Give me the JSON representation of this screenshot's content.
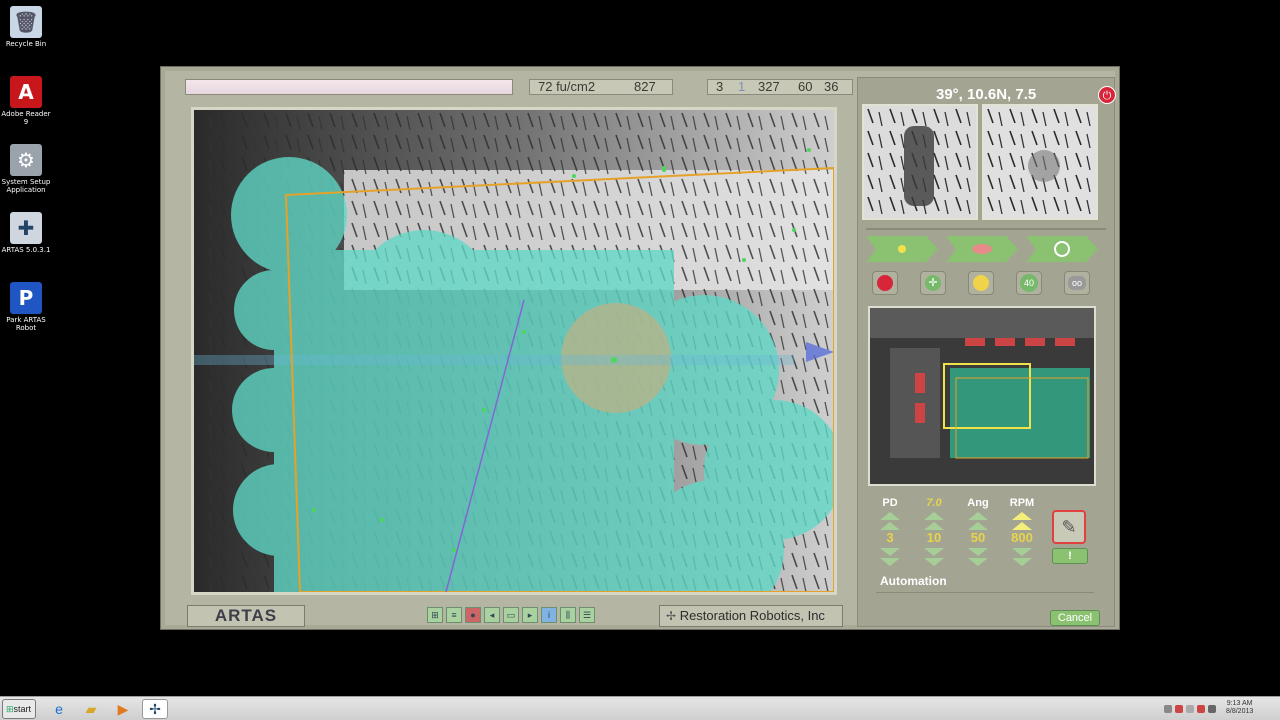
{
  "desktop": {
    "icons": [
      {
        "label": "Recycle Bin",
        "icon": "recycle-bin-icon",
        "color": "#c9d6e6"
      },
      {
        "label": "Adobe Reader 9",
        "icon": "adobe-reader-icon",
        "color": "#c8171b"
      },
      {
        "label": "System Setup Application",
        "icon": "gear-icon",
        "color": "#9aa3ab"
      },
      {
        "label": "ARTAS 5.0.3.1",
        "icon": "artas-icon",
        "color": "#cfd6df"
      },
      {
        "label": "Park ARTAS Robot",
        "icon": "park-icon",
        "color": "#1f56c4"
      }
    ]
  },
  "app": {
    "status": {
      "density": "72 fu/cm2",
      "count": "827",
      "field_a": "3",
      "field_b": "1",
      "field_c": "327",
      "field_d": "60",
      "field_e": "36"
    },
    "brand": "ARTAS",
    "company": "Restoration Robotics, Inc",
    "toolbar_icons": [
      "zoom-icon",
      "grid-icon",
      "record-icon",
      "back-icon",
      "image-icon",
      "forward-icon",
      "info-icon",
      "columns-icon",
      "list-icon"
    ],
    "side": {
      "angles": "39°, 10.6N, 7.5",
      "params": [
        {
          "label": "PD",
          "value": "3"
        },
        {
          "label": "7.0",
          "value": "10"
        },
        {
          "label": "Ang",
          "value": "50"
        },
        {
          "label": "RPM",
          "value": "800"
        }
      ],
      "exclaim": "!",
      "automation_label": "Automation",
      "cancel_label": "Cancel",
      "small_button_text": "40"
    },
    "colors": {
      "accent_green": "#8bc272",
      "cyan_overlay": "#5fd9c6",
      "orange_frame": "#e5a22a",
      "stop_red": "#d7263a"
    }
  },
  "taskbar": {
    "start_label": "start",
    "clock_time": "9:13 AM",
    "clock_date": "8/8/2013"
  }
}
